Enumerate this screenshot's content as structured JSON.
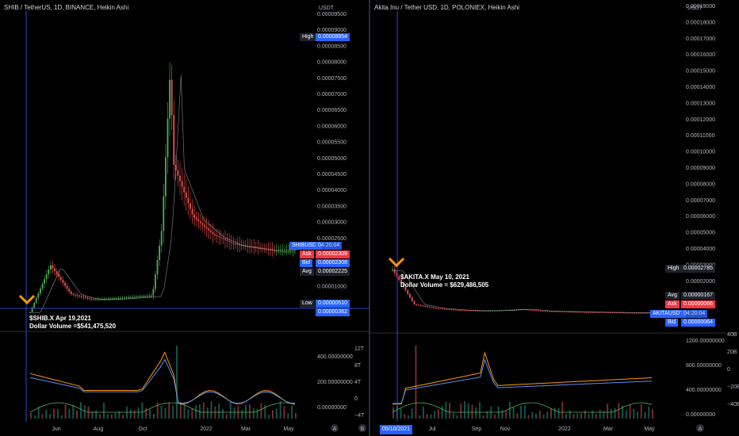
{
  "colors": {
    "bg": "#000000",
    "up": "#26a69a",
    "down": "#ef5350",
    "green_line": "#4caf50",
    "orange_line": "#ff9800",
    "blue_line": "#5b8def",
    "tag_blue": "#2962ff",
    "tag_red": "#f23645",
    "tag_dark": "#1e222d",
    "crosshair": "#2962ff"
  },
  "left_chart": {
    "title": "SHIB / TetherUS, 1D, BINANCE, Heikin Ashi",
    "unit": "USDT",
    "price_axis": [
      "0.00009500",
      "0.00009000",
      "0.00008500",
      "0.00008000",
      "0.00007500",
      "0.00007000",
      "0.00006500",
      "0.00006000",
      "0.00005500",
      "0.00005000",
      "0.00004500",
      "0.00004000",
      "0.00003500",
      "0.00003000",
      "0.00002500",
      "0.00002000",
      "0.00001500",
      "0.00001000",
      "0.00000500"
    ],
    "tags": {
      "high_label": "High",
      "high_value": "0.00008854",
      "symbol": "SHIBUSDT",
      "countdown": "04:20:04",
      "ask_label": "Ask",
      "ask_value": "0.00002309",
      "bid_label": "Bid",
      "bid_value": "0.00002308",
      "avg_label": "Avg",
      "avg_value": "0.00002225",
      "low_label": "Low",
      "low_value": "0.00000510",
      "cross_value": "0.00000362"
    },
    "annotation_line1": "$SHIB.X Apr 19,2021",
    "annotation_line2": "Dollar Volume =$541,475,520",
    "indicator_axis": [
      "400.00000000",
      "200.00000000",
      "0.00000000"
    ],
    "indicator_axis2": [
      "12T",
      "8T",
      "4T",
      "0",
      "−4T"
    ],
    "time_axis": [
      "Jun",
      "Aug",
      "Oct",
      "2022",
      "Mar",
      "May"
    ],
    "badge_a": "A",
    "badge_b": "B"
  },
  "right_chart": {
    "title": "Akita Inu / Tether USD, 1D, POLONIEX, Heikin Ashi",
    "unit": "USDT",
    "price_axis": [
      "0.00019000",
      "0.00018000",
      "0.00017000",
      "0.00016000",
      "0.00015000",
      "0.00014000",
      "0.00013000",
      "0.00012000",
      "0.00011000",
      "0.00010000",
      "0.00009000",
      "0.00008000",
      "0.00007000",
      "0.00006000",
      "0.00005000",
      "0.00004000",
      "0.00003000",
      "0.00002000",
      "0.00001000"
    ],
    "tags": {
      "high_label": "High",
      "high_value": "0.00002785",
      "avg_label": "Avg",
      "avg_value": "0.00000167",
      "ask_label": "Ask",
      "ask_value": "0.00000066",
      "symbol": "AKITAUSDT",
      "countdown": "04:20:04",
      "bid_label": "Bid",
      "bid_value": "0.00000064"
    },
    "annotation_line1": "$AKITA.X May 10, 2021",
    "annotation_line2": "Dollar Volume = $629,486,505",
    "indicator_axis": [
      "1200.00000000",
      "800.00000000",
      "400.00000000",
      "0.00000000"
    ],
    "indicator_axis2": [
      "40B",
      "20B",
      "0",
      "−20B",
      "−40B"
    ],
    "time_axis": [
      "Jul",
      "Sep",
      "Nov",
      "2022",
      "Mar",
      "May"
    ],
    "date_tag": "05/10/2021",
    "badge_a": "A"
  },
  "chart_data": [
    {
      "type": "line",
      "title": "SHIB / TetherUS, 1D, BINANCE, Heikin Ashi",
      "ylabel": "USDT",
      "x": [
        "2021-04",
        "2021-05",
        "2021-06",
        "2021-07",
        "2021-08",
        "2021-09",
        "2021-10-01",
        "2021-10-15",
        "2021-10-28",
        "2021-11",
        "2021-12",
        "2022-01",
        "2022-02",
        "2022-03",
        "2022-04",
        "2022-05"
      ],
      "series": [
        {
          "values": [
            2.5e-06,
            1.8e-05,
            8.5e-06,
            6.8e-06,
            7e-06,
            7.5e-06,
            8e-06,
            3e-05,
            8.5e-05,
            5.2e-05,
            3.4e-05,
            2.8e-05,
            2.5e-05,
            2.4e-05,
            2.3e-05,
            2.31e-05
          ]
        }
      ],
      "ylim": [
        3e-06,
        0.0001
      ]
    },
    {
      "type": "line",
      "title": "Akita Inu / Tether USD, 1D, POLONIEX, Heikin Ashi",
      "ylabel": "USDT",
      "x": [
        "2021-05",
        "2021-06",
        "2021-07",
        "2021-08",
        "2021-09",
        "2021-10",
        "2021-11",
        "2021-12",
        "2022-01",
        "2022-02",
        "2022-03",
        "2022-04",
        "2022-05"
      ],
      "series": [
        {
          "values": [
            2.78e-05,
            6e-06,
            3.5e-06,
            2.5e-06,
            2e-06,
            2.2e-06,
            3e-06,
            1.8e-06,
            1.5e-06,
            1.2e-06,
            1e-06,
            8e-07,
            6.6e-07
          ]
        }
      ],
      "ylim": [
        0,
        0.00019
      ]
    }
  ]
}
